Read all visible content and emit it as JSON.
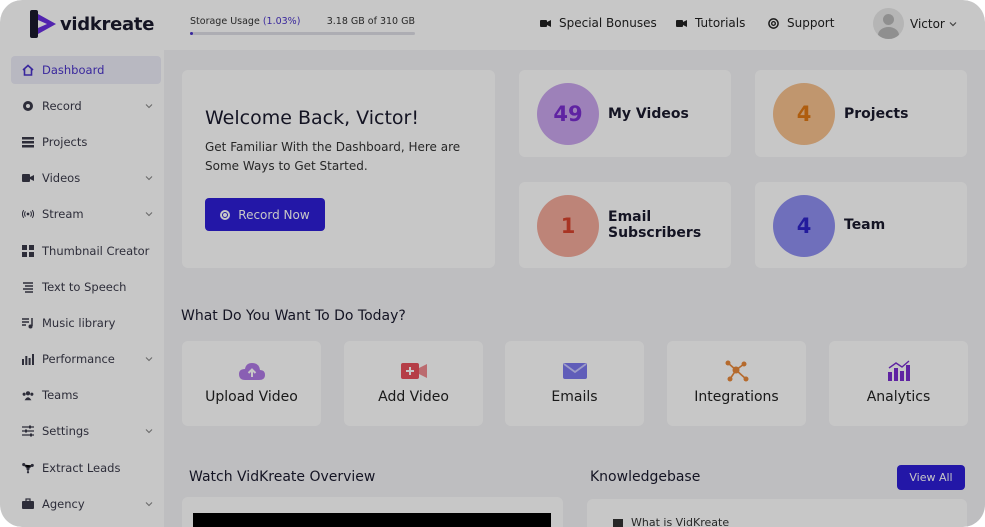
{
  "brand": {
    "name": "vidkreate"
  },
  "storage": {
    "label": "Storage Usage",
    "percent": "(1.03%)",
    "amount": "3.18 GB of 310 GB",
    "fill_fraction": 0.0103
  },
  "topnav": {
    "bonuses": "Special Bonuses",
    "tutorials": "Tutorials",
    "support": "Support"
  },
  "user": {
    "name": "Victor"
  },
  "sidebar": {
    "items": [
      {
        "label": "Dashboard",
        "icon": "home-icon",
        "has_submenu": false
      },
      {
        "label": "Record",
        "icon": "record-icon",
        "has_submenu": true
      },
      {
        "label": "Projects",
        "icon": "grid-list-icon",
        "has_submenu": false
      },
      {
        "label": "Videos",
        "icon": "video-camera-icon",
        "has_submenu": true
      },
      {
        "label": "Stream",
        "icon": "broadcast-icon",
        "has_submenu": true
      },
      {
        "label": "Thumbnail Creator",
        "icon": "tiles-icon",
        "has_submenu": false
      },
      {
        "label": "Text to Speech",
        "icon": "text-lines-icon",
        "has_submenu": false
      },
      {
        "label": "Music library",
        "icon": "music-list-icon",
        "has_submenu": false
      },
      {
        "label": "Performance",
        "icon": "bar-chart-icon",
        "has_submenu": true
      },
      {
        "label": "Teams",
        "icon": "users-icon",
        "has_submenu": false
      },
      {
        "label": "Settings",
        "icon": "sliders-icon",
        "has_submenu": true
      },
      {
        "label": "Extract Leads",
        "icon": "network-icon",
        "has_submenu": false
      },
      {
        "label": "Agency",
        "icon": "briefcase-icon",
        "has_submenu": true
      }
    ]
  },
  "welcome": {
    "title": "Welcome Back, Victor!",
    "subtitle": "Get Familiar With the Dashboard, Here are Some Ways to Get Started.",
    "button": "Record Now"
  },
  "stats": [
    {
      "value": "49",
      "label": "My Videos",
      "color": "#c9a6ee",
      "text_color": "#7a2ed0"
    },
    {
      "value": "4",
      "label": "Projects",
      "color": "#f6c08e",
      "text_color": "#e07812"
    },
    {
      "value": "1",
      "label": "Email Subscribers",
      "color": "#f3a99a",
      "text_color": "#d8432e"
    },
    {
      "value": "4",
      "label": "Team",
      "color": "#8f8ff0",
      "text_color": "#2d23c9"
    }
  ],
  "actions": {
    "title": "What Do You Want To Do Today?",
    "items": [
      {
        "label": "Upload Video",
        "icon": "cloud-upload-icon"
      },
      {
        "label": "Add Video",
        "icon": "add-video-icon"
      },
      {
        "label": "Emails",
        "icon": "envelope-icon"
      },
      {
        "label": "Integrations",
        "icon": "integrations-icon"
      },
      {
        "label": "Analytics",
        "icon": "analytics-icon"
      }
    ]
  },
  "overview": {
    "title": "Watch VidKreate Overview"
  },
  "knowledgebase": {
    "title": "Knowledgebase",
    "view_all": "View All",
    "first_item": "What is VidKreate"
  },
  "colors": {
    "accent": "#2d1ed6",
    "brand_purple": "#4a33c9"
  }
}
